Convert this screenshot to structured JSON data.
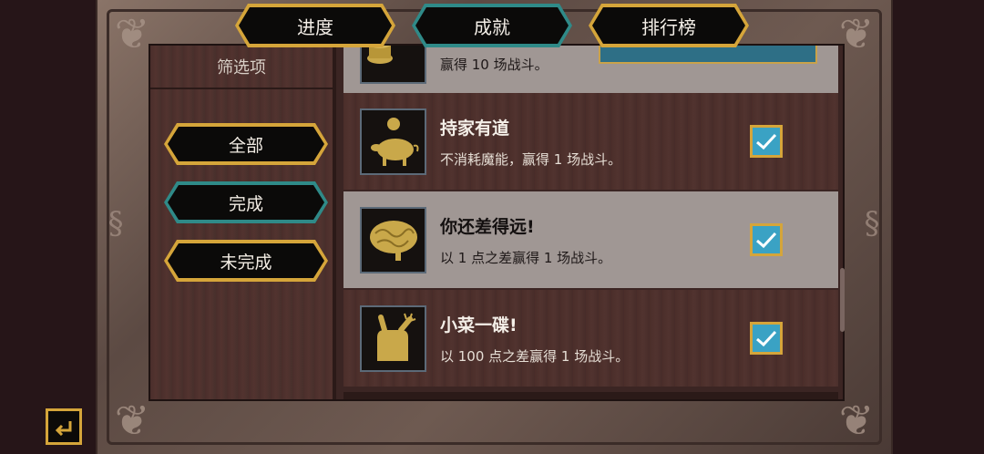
{
  "tabs": [
    {
      "label": "进度",
      "active": false
    },
    {
      "label": "成就",
      "active": true
    },
    {
      "label": "排行榜",
      "active": false
    }
  ],
  "filter": {
    "title": "筛选项",
    "options": [
      {
        "label": "全部",
        "selected": false
      },
      {
        "label": "完成",
        "selected": true
      },
      {
        "label": "未完成",
        "selected": false
      }
    ]
  },
  "achievements": {
    "partial": {
      "desc": "赢得 10 场战斗。"
    },
    "items": [
      {
        "name": "持家有道",
        "desc": "不消耗魔能，赢得 1 场战斗。",
        "icon": "pig-coin-icon",
        "completed": true
      },
      {
        "name": "你还差得远!",
        "desc": "以 1 点之差赢得 1 场战斗。",
        "icon": "brain-icon",
        "completed": true
      },
      {
        "name": "小菜一碟!",
        "desc": "以 100 点之差赢得 1 场战斗。",
        "icon": "snapping-hand-icon",
        "completed": true
      }
    ]
  },
  "colors": {
    "gold": "#d5a53a",
    "teal": "#2f8a88",
    "check_blue": "#3aa2c4"
  }
}
